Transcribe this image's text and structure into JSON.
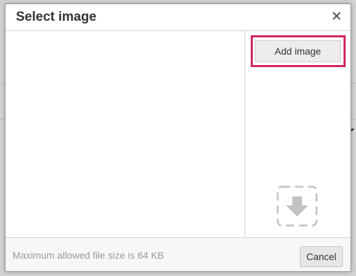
{
  "dialog": {
    "title": "Select image",
    "close_icon": "close-icon"
  },
  "side_panel": {
    "add_image_label": "Add image",
    "highlight_color": "#d3245f",
    "drop_icon": "download-arrow-icon"
  },
  "footer": {
    "note": "Maximum allowed file size is 64 KB",
    "cancel_label": "Cancel"
  }
}
